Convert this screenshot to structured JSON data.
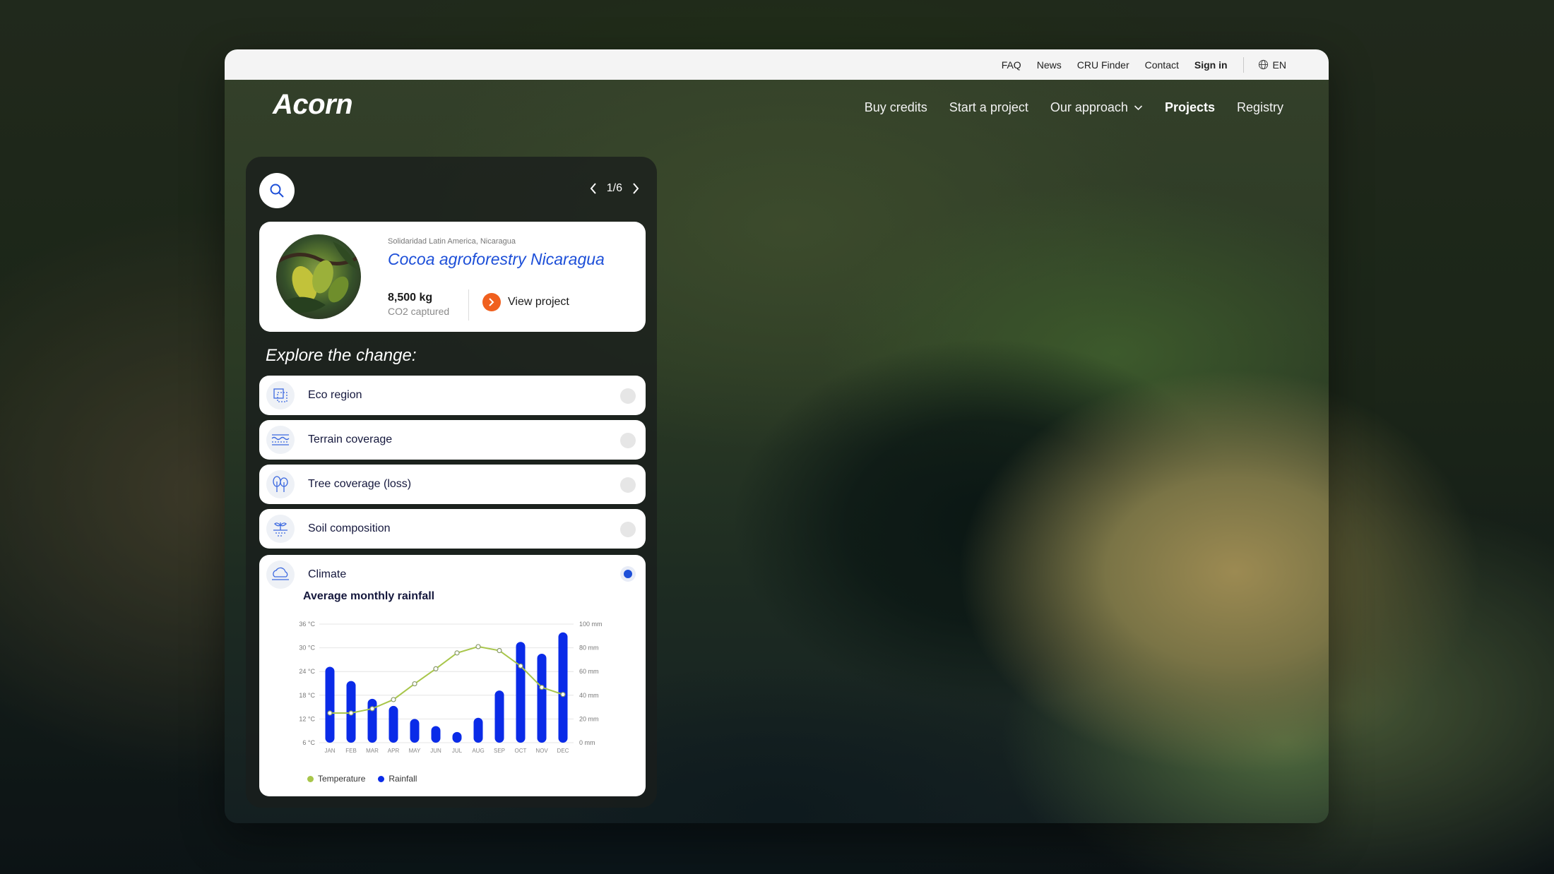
{
  "topbar": {
    "links": [
      "FAQ",
      "News",
      "CRU Finder",
      "Contact"
    ],
    "sign_in": "Sign in",
    "language": "EN"
  },
  "brand": {
    "logo_text": "Acorn"
  },
  "nav": {
    "buy_credits": "Buy credits",
    "start_project": "Start a project",
    "our_approach": "Our approach",
    "projects": "Projects",
    "registry": "Registry"
  },
  "panel": {
    "pager": "1/6",
    "project": {
      "organization": "Solidaridad Latin America, Nicaragua",
      "title": "Cocoa agroforestry Nicaragua",
      "co2_value": "8,500 kg",
      "co2_label": "CO2 captured",
      "view_label": "View project"
    },
    "explore_heading": "Explore the change:",
    "layers": [
      {
        "label": "Eco region",
        "icon": "eco-region-icon",
        "active": false
      },
      {
        "label": "Terrain coverage",
        "icon": "terrain-icon",
        "active": false
      },
      {
        "label": "Tree coverage (loss)",
        "icon": "tree-icon",
        "active": false
      },
      {
        "label": "Soil composition",
        "icon": "soil-icon",
        "active": false
      },
      {
        "label": "Climate",
        "icon": "cloud-icon",
        "active": true
      }
    ],
    "chart_title": "Average monthly rainfall"
  },
  "colors": {
    "accent_blue": "#1d4fd8",
    "bar_blue": "#0a2be8",
    "temperature_green": "#a8c64a",
    "orange": "#f0601e"
  },
  "chart_data": {
    "type": "bar",
    "categories": [
      "JAN",
      "FEB",
      "MAR",
      "APR",
      "MAY",
      "JUN",
      "JUL",
      "AUG",
      "SEP",
      "OCT",
      "NOV",
      "DEC"
    ],
    "series": [
      {
        "name": "Rainfall",
        "axis": "right",
        "kind": "bar",
        "values": [
          64,
          52,
          37,
          31,
          20,
          14,
          9,
          21,
          44,
          85,
          75,
          93
        ]
      },
      {
        "name": "Temperature",
        "axis": "left",
        "kind": "line",
        "values": [
          13.5,
          13.5,
          14.6,
          16.9,
          20.9,
          24.7,
          28.7,
          30.3,
          29.3,
          25.4,
          20.0,
          18.2
        ]
      }
    ],
    "y_left": {
      "ticks": [
        "36 °C",
        "30 °C",
        "24 °C",
        "18 °C",
        "12 °C",
        "6 °C"
      ],
      "range": [
        6,
        36
      ]
    },
    "y_right": {
      "ticks": [
        "100 mm",
        "80 mm",
        "60 mm",
        "40 mm",
        "20 mm",
        "0 mm"
      ],
      "range": [
        0,
        100
      ]
    },
    "legend": [
      "Temperature",
      "Rainfall"
    ],
    "legend_position": "bottom-left",
    "grid": true
  }
}
